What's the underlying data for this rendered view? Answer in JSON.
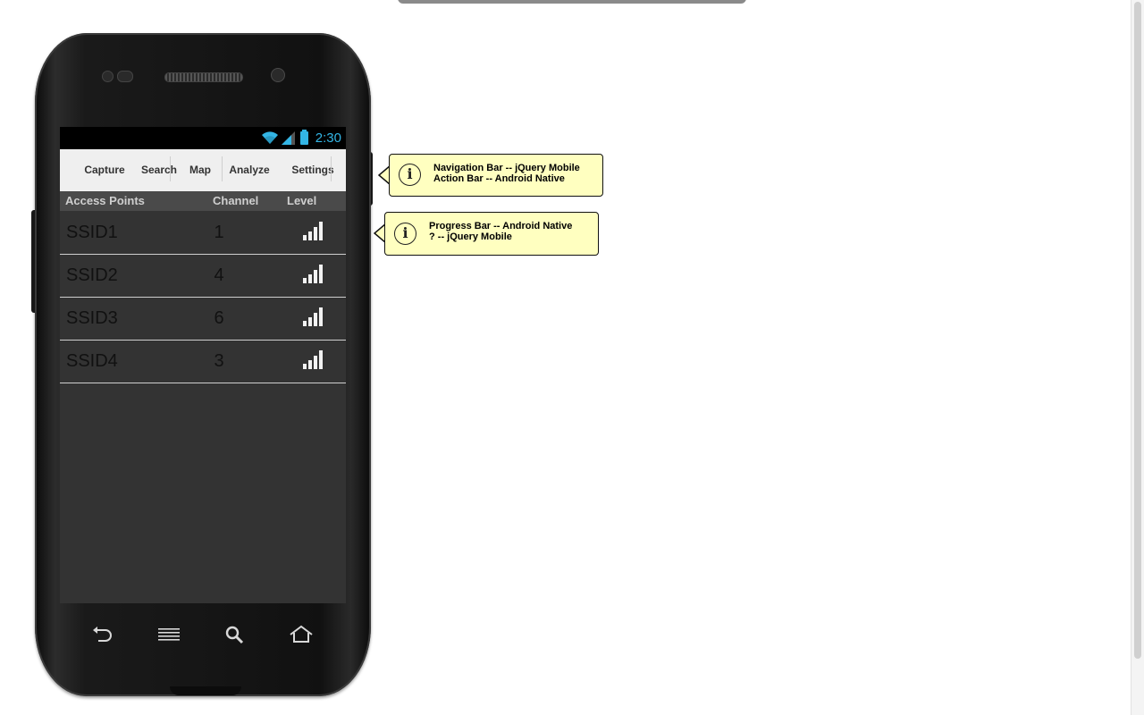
{
  "status_bar": {
    "time": "2:30",
    "icons": [
      "wifi-icon",
      "signal-icon",
      "battery-icon"
    ]
  },
  "nav_bar": {
    "items": [
      "Capture",
      "Search",
      "Map",
      "Analyze",
      "Settings"
    ]
  },
  "table": {
    "headers": {
      "access_points": "Access Points",
      "channel": "Channel",
      "level": "Level"
    },
    "rows": [
      {
        "ssid": "SSID1",
        "channel": "1",
        "level": "signal-full-icon"
      },
      {
        "ssid": "SSID2",
        "channel": "4",
        "level": "signal-full-icon"
      },
      {
        "ssid": "SSID3",
        "channel": "6",
        "level": "signal-full-icon"
      },
      {
        "ssid": "SSID4",
        "channel": "3",
        "level": "signal-full-icon"
      }
    ]
  },
  "hardware_buttons": [
    "back-icon",
    "menu-icon",
    "search-icon",
    "home-icon"
  ],
  "callouts": [
    {
      "line1": "Navigation Bar -- jQuery Mobile",
      "line2": "Action Bar -- Android Native"
    },
    {
      "line1": "Progress Bar -- Android Native",
      "line2": "? -- jQuery Mobile"
    }
  ],
  "colors": {
    "accent": "#33b5e5",
    "callout_bg": "#ffffc0",
    "screen_bg": "#333333",
    "navbar_bg": "#efefef"
  }
}
